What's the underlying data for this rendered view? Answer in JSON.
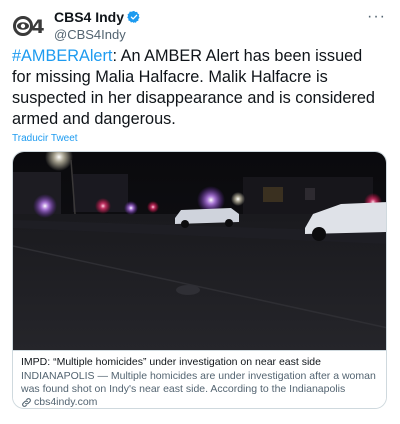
{
  "account": {
    "display_name": "CBS4 Indy",
    "handle": "@CBS4Indy",
    "verified_icon": "verified-badge-icon",
    "logo_text": "CBS4"
  },
  "tweet": {
    "hashtag": "#AMBERAlert",
    "body": ": An AMBER Alert has been issued for missing Malia Halfacre. Malik Halfacre is suspected in her disappearance and is considered armed and dangerous.",
    "translate_label": "Traducir Tweet"
  },
  "more_icon": "more-options-icon",
  "link_card": {
    "title": "IMPD: “Multiple homicides” under investigation on near east side",
    "description": "INDIANAPOLIS — Multiple homicides are under investigation after a woman was found shot on Indy's near east side. According to the Indianapolis Metropolitan ...",
    "domain": "cbs4indy.com",
    "link_icon": "link-icon"
  },
  "colors": {
    "accent": "#1d9bf0",
    "text": "#0f1419",
    "secondary": "#536471",
    "border": "#cfd9de",
    "logo": "#3a3a3a"
  }
}
